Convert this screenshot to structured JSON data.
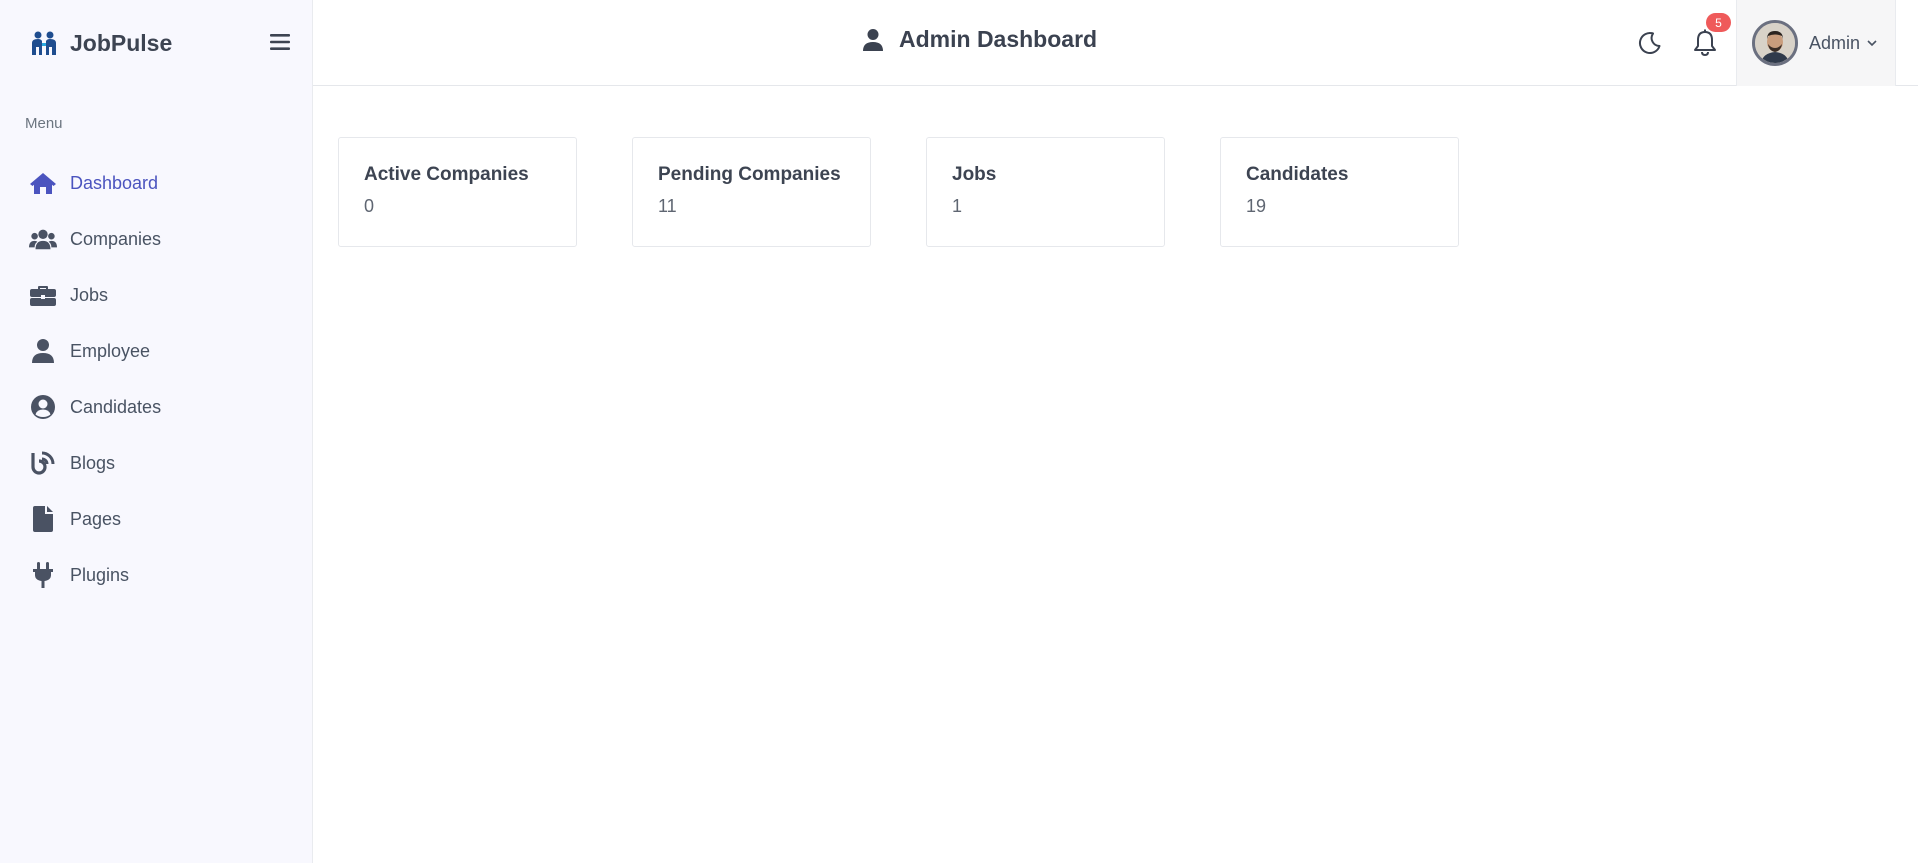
{
  "brand": {
    "name": "JobPulse"
  },
  "sidebar": {
    "heading": "Menu",
    "items": [
      {
        "label": "Dashboard",
        "icon": "home-icon",
        "active": true
      },
      {
        "label": "Companies",
        "icon": "users-icon"
      },
      {
        "label": "Jobs",
        "icon": "briefcase-icon"
      },
      {
        "label": "Employee",
        "icon": "user-icon"
      },
      {
        "label": "Candidates",
        "icon": "user-circle-icon"
      },
      {
        "label": "Blogs",
        "icon": "blog-icon"
      },
      {
        "label": "Pages",
        "icon": "file-icon"
      },
      {
        "label": "Plugins",
        "icon": "plug-icon"
      }
    ]
  },
  "header": {
    "title": "Admin Dashboard",
    "notifications_count": "5",
    "user_name": "Admin"
  },
  "stats": [
    {
      "title": "Active Companies",
      "value": "0"
    },
    {
      "title": "Pending Companies",
      "value": "11"
    },
    {
      "title": "Jobs",
      "value": "1"
    },
    {
      "title": "Candidates",
      "value": "19"
    }
  ],
  "colors": {
    "accent": "#4b54bf",
    "sidebar_bg": "#f8f8fe",
    "badge": "#ef5a5a",
    "text": "#495363"
  }
}
